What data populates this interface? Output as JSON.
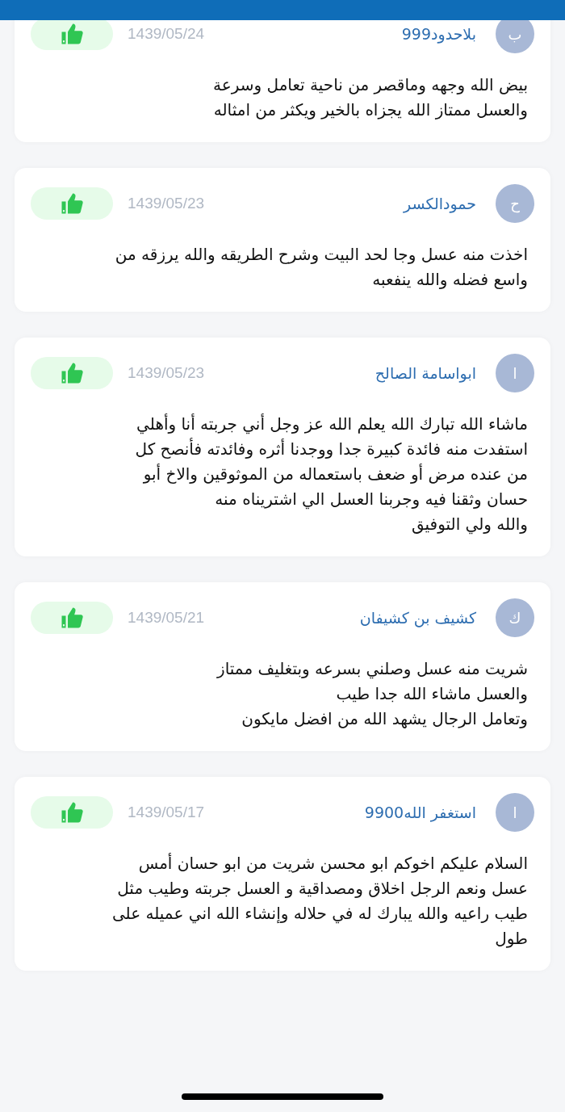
{
  "reviews": [
    {
      "avatar": "ب",
      "name": "بلاحدود999",
      "date": "1439/05/24",
      "text": "بيض الله وجهه وماقصر من ناحية تعامل وسرعة\nوالعسل ممتاز الله يجزاه بالخير ويكثر من امثاله"
    },
    {
      "avatar": "ح",
      "name": "حمودالكسر",
      "date": "1439/05/23",
      "text": "اخذت منه عسل وجا لحد البيت وشرح الطريقه والله يرزقه من\nواسع فضله والله ينفعبه"
    },
    {
      "avatar": "ا",
      "name": "ابواسامة الصالح",
      "date": "1439/05/23",
      "text": "ماشاء الله تبارك الله يعلم الله عز وجل أني جربته أنا وأهلي\nاستفدت منه فائدة كبيرة جدا ووجدنا أثره وفائدته فأنصح كل\nمن عنده مرض أو ضعف باستعماله من الموثوقين والاخ أبو\nحسان وثقنا فيه وجربنا العسل الي اشتريناه منه\nوالله ولي التوفيق"
    },
    {
      "avatar": "ك",
      "name": "كشيف بن كشيفان",
      "date": "1439/05/21",
      "text": "شريت منه عسل وصلني بسرعه وبتغليف ممتاز\nوالعسل ماشاء الله جدا طيب\nوتعامل الرجال يشهد الله من افضل مايكون\n"
    },
    {
      "avatar": "ا",
      "name": "استغفر الله9900",
      "date": "1439/05/17",
      "text": "السلام عليكم اخوكم ابو محسن شريت من ابو حسان أمس\nعسل ونعم الرجل اخلاق ومصداقية و العسل جربته وطيب مثل\nطيب راعيه والله يبارك له في حلاله وإنشاء الله اني عميله على\nطول"
    }
  ]
}
